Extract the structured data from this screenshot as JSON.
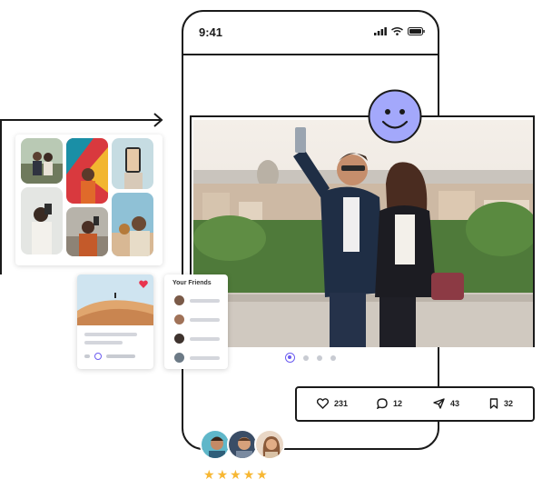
{
  "status_bar": {
    "time": "9:41"
  },
  "friends_card": {
    "title": "Your Friends",
    "friends": [
      {
        "avatar_color": "#7a5a48"
      },
      {
        "avatar_color": "#a07258"
      },
      {
        "avatar_color": "#3e332e"
      },
      {
        "avatar_color": "#6c7a86"
      }
    ]
  },
  "carousel": {
    "count": 4,
    "active_index": 0
  },
  "stats": {
    "likes": "231",
    "comments": "12",
    "shares": "43",
    "saves": "32"
  },
  "rating": {
    "stars": 5
  },
  "colors": {
    "accent": "#6b5cf0",
    "smiley": "#a3a8fb",
    "star": "#f7b733",
    "like_heart": "#e8344e",
    "outline": "#1a1a1a"
  },
  "icons": [
    "heart-icon",
    "comment-icon",
    "send-icon",
    "bookmark-icon",
    "smiley-icon",
    "signal-icon",
    "wifi-icon",
    "battery-icon",
    "star-icon"
  ]
}
